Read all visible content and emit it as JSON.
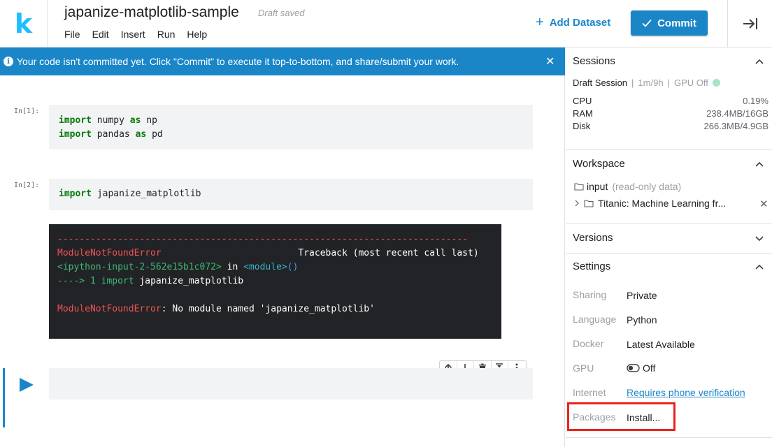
{
  "header": {
    "logo": "k",
    "title": "japanize-matplotlib-sample",
    "status": "Draft saved",
    "menu": [
      "File",
      "Edit",
      "Insert",
      "Run",
      "Help"
    ],
    "add_dataset_label": "Add Dataset",
    "commit_label": "Commit"
  },
  "banner": {
    "message": "Your code isn't committed yet. Click \"Commit\" to execute it top-to-bottom, and share/submit your work.",
    "close": "✕"
  },
  "cells": [
    {
      "prompt": "In[1]:",
      "lines": [
        {
          "kw": "import",
          "mid": " numpy ",
          "kw2": "as",
          "tail": " np"
        },
        {
          "kw": "import",
          "mid": " pandas ",
          "kw2": "as",
          "tail": " pd"
        }
      ]
    },
    {
      "prompt": "In[2]:",
      "lines": [
        {
          "kw": "import",
          "mid": " japanize_matplotlib",
          "kw2": "",
          "tail": ""
        }
      ]
    }
  ],
  "error_output": {
    "dashes": "---------------------------------------------------------------------------",
    "error_name": "ModuleNotFoundError",
    "traceback_label": "                         Traceback (most recent call last)",
    "input_ref": "<ipython-input-2-562e15b1c072>",
    "in_word": " in ",
    "module_ref": "<module>",
    "module_parens": "()",
    "arrow": "----> 1 ",
    "arrow_import": "import",
    "arrow_rest": " japanize_matplotlib",
    "final_name": "ModuleNotFoundError",
    "final_msg": ": No module named 'japanize_matplotlib'"
  },
  "sidebar": {
    "sessions": {
      "title": "Sessions",
      "session_name": "Draft Session",
      "time": "1m/9h",
      "gpu": "GPU Off",
      "gpu_status_color": "#a7e3c6",
      "stats": [
        {
          "label": "CPU",
          "value": "0.19%"
        },
        {
          "label": "RAM",
          "value": "238.4MB/16GB"
        },
        {
          "label": "Disk",
          "value": "266.3MB/4.9GB"
        }
      ]
    },
    "workspace": {
      "title": "Workspace",
      "input_label": "input",
      "input_note": "(read-only data)",
      "dataset": "Titanic: Machine Learning fr..."
    },
    "versions": {
      "title": "Versions"
    },
    "settings": {
      "title": "Settings",
      "rows": [
        {
          "label": "Sharing",
          "value": "Private"
        },
        {
          "label": "Language",
          "value": "Python"
        },
        {
          "label": "Docker",
          "value": "Latest Available"
        },
        {
          "label": "GPU",
          "value": "Off"
        },
        {
          "label": "Internet",
          "value": "Requires phone verification"
        },
        {
          "label": "Packages",
          "value": "Install..."
        }
      ]
    }
  },
  "colors": {
    "accent": "#1a86c8",
    "logo": "#20beff",
    "highlight": "#e8231d"
  }
}
